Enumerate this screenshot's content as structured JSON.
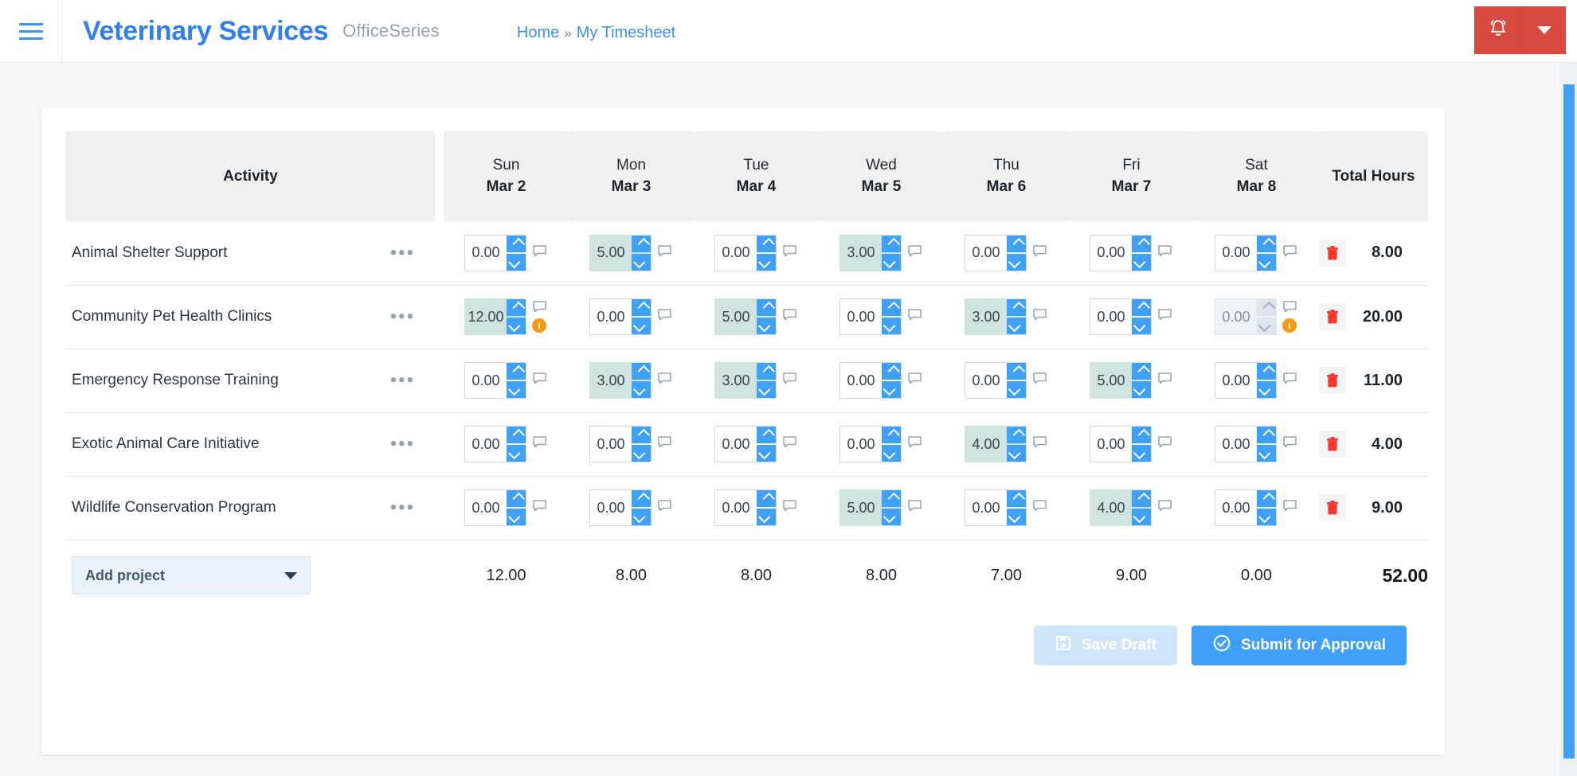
{
  "header": {
    "menu_icon": "hamburger-menu-icon",
    "brand": "Veterinary Services",
    "subbrand": "OfficeSeries",
    "breadcrumb": {
      "home": "Home",
      "separator": "»",
      "current": "My Timesheet"
    },
    "bell_icon": "notification-bell-icon",
    "bell_caret_icon": "chevron-down-icon",
    "accent_red": "#d8483e",
    "accent_blue": "#3fa0f8"
  },
  "table": {
    "activity_header": "Activity",
    "total_header": "Total Hours",
    "days": [
      {
        "day": "Sun",
        "date": "Mar 2"
      },
      {
        "day": "Mon",
        "date": "Mar 3"
      },
      {
        "day": "Tue",
        "date": "Mar 4"
      },
      {
        "day": "Wed",
        "date": "Mar 5"
      },
      {
        "day": "Thu",
        "date": "Mar 6"
      },
      {
        "day": "Fri",
        "date": "Mar 7"
      },
      {
        "day": "Sat",
        "date": "Mar 8"
      }
    ],
    "rows": [
      {
        "activity": "Animal Shelter Support",
        "menu_icon": "ellipsis-menu-icon",
        "delete_icon": "trash-icon",
        "total": "8.00",
        "cells": [
          {
            "value": "0.00",
            "filled": false,
            "disabled": false,
            "info": false
          },
          {
            "value": "5.00",
            "filled": true,
            "disabled": false,
            "info": false
          },
          {
            "value": "0.00",
            "filled": false,
            "disabled": false,
            "info": false
          },
          {
            "value": "3.00",
            "filled": true,
            "disabled": false,
            "info": false
          },
          {
            "value": "0.00",
            "filled": false,
            "disabled": false,
            "info": false
          },
          {
            "value": "0.00",
            "filled": false,
            "disabled": false,
            "info": false
          },
          {
            "value": "0.00",
            "filled": false,
            "disabled": false,
            "info": false
          }
        ]
      },
      {
        "activity": "Community Pet Health Clinics",
        "menu_icon": "ellipsis-menu-icon",
        "delete_icon": "trash-icon",
        "total": "20.00",
        "cells": [
          {
            "value": "12.00",
            "filled": true,
            "disabled": false,
            "info": true
          },
          {
            "value": "0.00",
            "filled": false,
            "disabled": false,
            "info": false
          },
          {
            "value": "5.00",
            "filled": true,
            "disabled": false,
            "info": false
          },
          {
            "value": "0.00",
            "filled": false,
            "disabled": false,
            "info": false
          },
          {
            "value": "3.00",
            "filled": true,
            "disabled": false,
            "info": false
          },
          {
            "value": "0.00",
            "filled": false,
            "disabled": false,
            "info": false
          },
          {
            "value": "0.00",
            "filled": false,
            "disabled": true,
            "info": true
          }
        ]
      },
      {
        "activity": "Emergency Response Training",
        "menu_icon": "ellipsis-menu-icon",
        "delete_icon": "trash-icon",
        "total": "11.00",
        "cells": [
          {
            "value": "0.00",
            "filled": false,
            "disabled": false,
            "info": false
          },
          {
            "value": "3.00",
            "filled": true,
            "disabled": false,
            "info": false
          },
          {
            "value": "3.00",
            "filled": true,
            "disabled": false,
            "info": false
          },
          {
            "value": "0.00",
            "filled": false,
            "disabled": false,
            "info": false
          },
          {
            "value": "0.00",
            "filled": false,
            "disabled": false,
            "info": false
          },
          {
            "value": "5.00",
            "filled": true,
            "disabled": false,
            "info": false
          },
          {
            "value": "0.00",
            "filled": false,
            "disabled": false,
            "info": false
          }
        ]
      },
      {
        "activity": "Exotic Animal Care Initiative",
        "menu_icon": "ellipsis-menu-icon",
        "delete_icon": "trash-icon",
        "total": "4.00",
        "cells": [
          {
            "value": "0.00",
            "filled": false,
            "disabled": false,
            "info": false
          },
          {
            "value": "0.00",
            "filled": false,
            "disabled": false,
            "info": false
          },
          {
            "value": "0.00",
            "filled": false,
            "disabled": false,
            "info": false
          },
          {
            "value": "0.00",
            "filled": false,
            "disabled": false,
            "info": false
          },
          {
            "value": "4.00",
            "filled": true,
            "disabled": false,
            "info": false
          },
          {
            "value": "0.00",
            "filled": false,
            "disabled": false,
            "info": false
          },
          {
            "value": "0.00",
            "filled": false,
            "disabled": false,
            "info": false
          }
        ]
      },
      {
        "activity": "Wildlife Conservation Program",
        "menu_icon": "ellipsis-menu-icon",
        "delete_icon": "trash-icon",
        "total": "9.00",
        "cells": [
          {
            "value": "0.00",
            "filled": false,
            "disabled": false,
            "info": false
          },
          {
            "value": "0.00",
            "filled": false,
            "disabled": false,
            "info": false
          },
          {
            "value": "0.00",
            "filled": false,
            "disabled": false,
            "info": false
          },
          {
            "value": "5.00",
            "filled": true,
            "disabled": false,
            "info": false
          },
          {
            "value": "0.00",
            "filled": false,
            "disabled": false,
            "info": false
          },
          {
            "value": "4.00",
            "filled": true,
            "disabled": false,
            "info": false
          },
          {
            "value": "0.00",
            "filled": false,
            "disabled": false,
            "info": false
          }
        ]
      }
    ],
    "totals_row": {
      "add_project_label": "Add project",
      "add_project_caret_icon": "chevron-down-icon",
      "day_totals": [
        "12.00",
        "8.00",
        "8.00",
        "8.00",
        "7.00",
        "9.00",
        "0.00"
      ],
      "grand_total": "52.00"
    }
  },
  "footer": {
    "save_draft_label": "Save Draft",
    "save_draft_icon": "floppy-disk-icon",
    "submit_label": "Submit for Approval",
    "submit_icon": "check-circle-icon"
  }
}
